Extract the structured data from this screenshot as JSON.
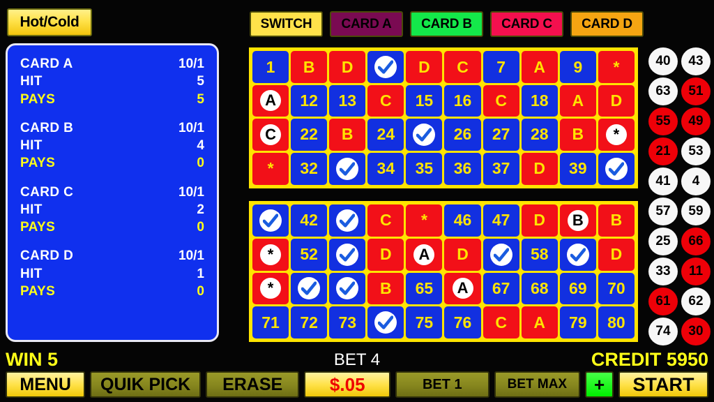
{
  "hotcold": {
    "label": "Hot/Cold"
  },
  "info_panel": {
    "cards": [
      {
        "name": "CARD A",
        "odds": "10/1",
        "hit_label": "HIT",
        "hit": "5",
        "pays_label": "PAYS",
        "pays": "5"
      },
      {
        "name": "CARD B",
        "odds": "10/1",
        "hit_label": "HIT",
        "hit": "4",
        "pays_label": "PAYS",
        "pays": "0"
      },
      {
        "name": "CARD C",
        "odds": "10/1",
        "hit_label": "HIT",
        "hit": "2",
        "pays_label": "PAYS",
        "pays": "0"
      },
      {
        "name": "CARD D",
        "odds": "10/1",
        "hit_label": "HIT",
        "hit": "1",
        "pays_label": "PAYS",
        "pays": "0"
      }
    ]
  },
  "card_bar": [
    {
      "label": "SWITCH",
      "color": "#ffe24a",
      "active": true
    },
    {
      "label": "CARD A",
      "color": "#7a0a52",
      "active": false
    },
    {
      "label": "CARD B",
      "color": "#14e84a",
      "active": true
    },
    {
      "label": "CARD C",
      "color": "#f4104e",
      "active": true
    },
    {
      "label": "CARD D",
      "color": "#f5a512",
      "active": true
    }
  ],
  "grids": [
    {
      "id": "grid-top",
      "cells": [
        {
          "text": "1",
          "bg": "blue",
          "style": "plain"
        },
        {
          "text": "B",
          "bg": "red",
          "style": "plain"
        },
        {
          "text": "D",
          "bg": "red",
          "style": "plain"
        },
        {
          "text": "check",
          "bg": "blue",
          "style": "check"
        },
        {
          "text": "D",
          "bg": "red",
          "style": "plain"
        },
        {
          "text": "C",
          "bg": "red",
          "style": "plain"
        },
        {
          "text": "7",
          "bg": "blue",
          "style": "plain"
        },
        {
          "text": "A",
          "bg": "red",
          "style": "plain"
        },
        {
          "text": "9",
          "bg": "blue",
          "style": "plain"
        },
        {
          "text": "*",
          "bg": "red",
          "style": "plain"
        },
        {
          "text": "A",
          "bg": "red",
          "style": "circle"
        },
        {
          "text": "12",
          "bg": "blue",
          "style": "plain"
        },
        {
          "text": "13",
          "bg": "blue",
          "style": "plain"
        },
        {
          "text": "C",
          "bg": "red",
          "style": "plain"
        },
        {
          "text": "15",
          "bg": "blue",
          "style": "plain"
        },
        {
          "text": "16",
          "bg": "blue",
          "style": "plain"
        },
        {
          "text": "C",
          "bg": "red",
          "style": "plain"
        },
        {
          "text": "18",
          "bg": "blue",
          "style": "plain"
        },
        {
          "text": "A",
          "bg": "red",
          "style": "plain"
        },
        {
          "text": "D",
          "bg": "red",
          "style": "plain"
        },
        {
          "text": "C",
          "bg": "red",
          "style": "circle"
        },
        {
          "text": "22",
          "bg": "blue",
          "style": "plain"
        },
        {
          "text": "B",
          "bg": "red",
          "style": "plain"
        },
        {
          "text": "24",
          "bg": "blue",
          "style": "plain"
        },
        {
          "text": "check",
          "bg": "blue",
          "style": "check"
        },
        {
          "text": "26",
          "bg": "blue",
          "style": "plain"
        },
        {
          "text": "27",
          "bg": "blue",
          "style": "plain"
        },
        {
          "text": "28",
          "bg": "blue",
          "style": "plain"
        },
        {
          "text": "B",
          "bg": "red",
          "style": "plain"
        },
        {
          "text": "*",
          "bg": "red",
          "style": "circle"
        },
        {
          "text": "*",
          "bg": "red",
          "style": "plain"
        },
        {
          "text": "32",
          "bg": "blue",
          "style": "plain"
        },
        {
          "text": "check",
          "bg": "blue",
          "style": "check"
        },
        {
          "text": "34",
          "bg": "blue",
          "style": "plain"
        },
        {
          "text": "35",
          "bg": "blue",
          "style": "plain"
        },
        {
          "text": "36",
          "bg": "blue",
          "style": "plain"
        },
        {
          "text": "37",
          "bg": "blue",
          "style": "plain"
        },
        {
          "text": "D",
          "bg": "red",
          "style": "plain"
        },
        {
          "text": "39",
          "bg": "blue",
          "style": "plain"
        },
        {
          "text": "check",
          "bg": "blue",
          "style": "check"
        }
      ]
    },
    {
      "id": "grid-bottom",
      "cells": [
        {
          "text": "check",
          "bg": "blue",
          "style": "check"
        },
        {
          "text": "42",
          "bg": "blue",
          "style": "plain"
        },
        {
          "text": "check",
          "bg": "blue",
          "style": "check"
        },
        {
          "text": "C",
          "bg": "red",
          "style": "plain"
        },
        {
          "text": "*",
          "bg": "red",
          "style": "plain"
        },
        {
          "text": "46",
          "bg": "blue",
          "style": "plain"
        },
        {
          "text": "47",
          "bg": "blue",
          "style": "plain"
        },
        {
          "text": "D",
          "bg": "red",
          "style": "plain"
        },
        {
          "text": "B",
          "bg": "red",
          "style": "circle"
        },
        {
          "text": "B",
          "bg": "red",
          "style": "plain"
        },
        {
          "text": "*",
          "bg": "red",
          "style": "circle"
        },
        {
          "text": "52",
          "bg": "blue",
          "style": "plain"
        },
        {
          "text": "check",
          "bg": "blue",
          "style": "check"
        },
        {
          "text": "D",
          "bg": "red",
          "style": "plain"
        },
        {
          "text": "A",
          "bg": "red",
          "style": "circle"
        },
        {
          "text": "D",
          "bg": "red",
          "style": "plain"
        },
        {
          "text": "check",
          "bg": "blue",
          "style": "check"
        },
        {
          "text": "58",
          "bg": "blue",
          "style": "plain"
        },
        {
          "text": "check",
          "bg": "blue",
          "style": "check"
        },
        {
          "text": "D",
          "bg": "red",
          "style": "plain"
        },
        {
          "text": "*",
          "bg": "red",
          "style": "circle"
        },
        {
          "text": "check",
          "bg": "blue",
          "style": "check"
        },
        {
          "text": "check",
          "bg": "blue",
          "style": "check"
        },
        {
          "text": "B",
          "bg": "red",
          "style": "plain"
        },
        {
          "text": "65",
          "bg": "blue",
          "style": "plain"
        },
        {
          "text": "A",
          "bg": "red",
          "style": "circle"
        },
        {
          "text": "67",
          "bg": "blue",
          "style": "plain"
        },
        {
          "text": "68",
          "bg": "blue",
          "style": "plain"
        },
        {
          "text": "69",
          "bg": "blue",
          "style": "plain"
        },
        {
          "text": "70",
          "bg": "blue",
          "style": "plain"
        },
        {
          "text": "71",
          "bg": "blue",
          "style": "plain"
        },
        {
          "text": "72",
          "bg": "blue",
          "style": "plain"
        },
        {
          "text": "73",
          "bg": "blue",
          "style": "plain"
        },
        {
          "text": "check",
          "bg": "blue",
          "style": "check"
        },
        {
          "text": "75",
          "bg": "blue",
          "style": "plain"
        },
        {
          "text": "76",
          "bg": "blue",
          "style": "plain"
        },
        {
          "text": "C",
          "bg": "red",
          "style": "plain"
        },
        {
          "text": "A",
          "bg": "red",
          "style": "plain"
        },
        {
          "text": "79",
          "bg": "blue",
          "style": "plain"
        },
        {
          "text": "80",
          "bg": "blue",
          "style": "plain"
        }
      ]
    }
  ],
  "drawn_balls": [
    {
      "number": "40",
      "color": "white"
    },
    {
      "number": "43",
      "color": "white"
    },
    {
      "number": "63",
      "color": "white"
    },
    {
      "number": "51",
      "color": "red"
    },
    {
      "number": "55",
      "color": "red"
    },
    {
      "number": "49",
      "color": "red"
    },
    {
      "number": "21",
      "color": "red"
    },
    {
      "number": "53",
      "color": "white"
    },
    {
      "number": "41",
      "color": "white"
    },
    {
      "number": "4",
      "color": "white"
    },
    {
      "number": "57",
      "color": "white"
    },
    {
      "number": "59",
      "color": "white"
    },
    {
      "number": "25",
      "color": "white"
    },
    {
      "number": "66",
      "color": "red"
    },
    {
      "number": "33",
      "color": "white"
    },
    {
      "number": "11",
      "color": "red"
    },
    {
      "number": "61",
      "color": "red"
    },
    {
      "number": "62",
      "color": "white"
    },
    {
      "number": "74",
      "color": "white"
    },
    {
      "number": "30",
      "color": "red"
    }
  ],
  "status": {
    "win": "WIN 5",
    "bet": "BET 4",
    "credit": "CREDIT 5950"
  },
  "buttons": {
    "menu": "MENU",
    "quik_pick": "QUIK PICK",
    "erase": "ERASE",
    "denomination": "$.05",
    "bet_1": "BET 1",
    "bet_max": "BET MAX",
    "plus": "+",
    "start": "START"
  },
  "colors": {
    "cell_blue": "#1230e0",
    "cell_red": "#f21018",
    "grid_border": "#ffe400",
    "cell_text": "#ffe400",
    "panel_blue": "#1030ee",
    "accent_yellow": "#ffff18",
    "ball_red": "#ee0008"
  }
}
